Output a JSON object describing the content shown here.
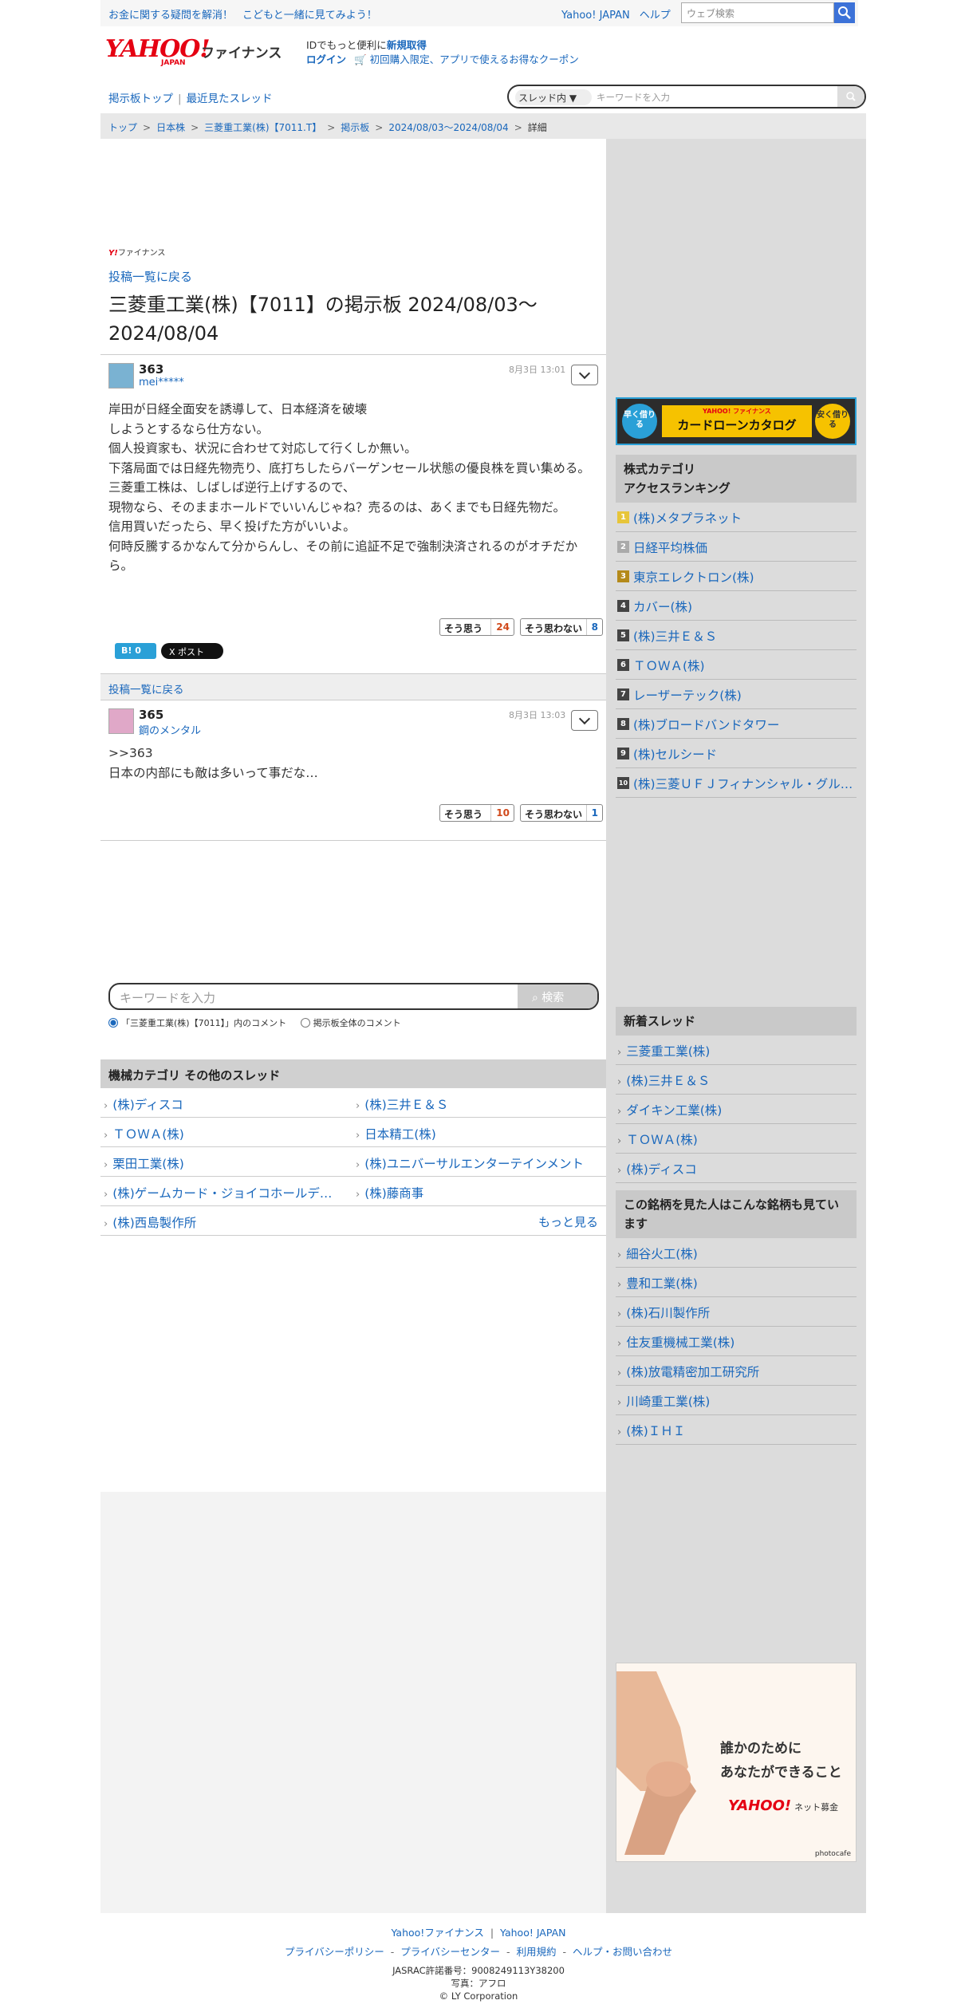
{
  "topbar": {
    "promo_1": "お金に関する疑問を解消！",
    "promo_2": "こどもと一緒に見てみよう！",
    "link_yahoo": "Yahoo! JAPAN",
    "link_help": "ヘルプ",
    "search_placeholder": "ウェブ検索"
  },
  "header": {
    "logo_yahoo": "YAHOO!",
    "logo_japan": "JAPAN",
    "logo_finance": "ファイナンス",
    "id_text": "IDでもっと便利に",
    "id_signup": "新規取得",
    "login": "ログイン",
    "coupon": "初回購入限定、アプリで使えるお得なクーポン"
  },
  "subnav": {
    "board_top": "掲示板トップ",
    "recent": "最近見たスレッド"
  },
  "thread_search": {
    "scope": "スレッド内",
    "placeholder": "キーワードを入力"
  },
  "breadcrumb": [
    "トップ",
    "日本株",
    "三菱重工業(株)【7011.T】",
    "掲示板",
    "2024/08/03〜2024/08/04",
    "詳細"
  ],
  "main": {
    "small_logo_y": "Y!",
    "small_logo_text": "ファイナンス",
    "back_label": "投稿一覧に戻る",
    "title": "三菱重工業(株)【7011】の掲示板 2024/08/03〜2024/08/04",
    "posts": [
      {
        "num": "363",
        "user": "mei*****",
        "date": "8月3日 13:01",
        "lines": [
          "岸田が日経全面安を誘導して、日本経済を破壊",
          "しようとするなら仕方ない。",
          "個人投資家も、状況に合わせて対応して行くしか無い。",
          "下落局面では日経先物売り、底打ちしたらバーゲンセール状態の優良株を買い集める。",
          "三菱重工株は、しばしば逆行上げするので、",
          "現物なら、そのままホールドでいいんじゃね？売るのは、あくまでも日経先物だ。",
          "信用買いだったら、早く投げた方がいいよ。",
          "何時反騰するかなんて分からんし、その前に追証不足で強制決済されるのがオチだから。"
        ],
        "yes_label": "そう思う",
        "yes_count": "24",
        "no_label": "そう思わない",
        "no_count": "8"
      },
      {
        "num": "365",
        "user": "鋼のメンタル",
        "date": "8月3日 13:03",
        "lines": [
          ">>363",
          "日本の内部にも敵は多いって事だな…"
        ],
        "yes_label": "そう思う",
        "yes_count": "10",
        "no_label": "そう思わない",
        "no_count": "1"
      }
    ],
    "hatena": "B! 0",
    "xpost": "X ポスト",
    "keyword_search": {
      "placeholder": "キーワードを入力",
      "button": "検索",
      "scope_1": "「三菱重工業(株)【7011】」内のコメント",
      "scope_2": "掲示板全体のコメント"
    },
    "category": {
      "heading": "機械カテゴリ その他のスレッド",
      "items": [
        "(株)ディスコ",
        "(株)三井Ｅ＆Ｓ",
        "ＴＯＷＡ(株)",
        "日本精工(株)",
        "栗田工業(株)",
        "(株)ユニバーサルエンターテインメント",
        "(株)ゲームカード・ジョイコホールデ…",
        "(株)藤商事",
        "(株)西島製作所"
      ],
      "more": "もっと見る"
    }
  },
  "right": {
    "banner": {
      "left": "早く借りる",
      "brand": "YAHOO! ファイナンス",
      "title": "カードローンカタログ",
      "right": "安く借りる"
    },
    "ranking_heading_1": "株式カテゴリ",
    "ranking_heading_2": "アクセスランキング",
    "ranking": [
      "(株)メタプラネット",
      "日経平均株価",
      "東京エレクトロン(株)",
      "カバー(株)",
      "(株)三井Ｅ＆Ｓ",
      "ＴＯＷＡ(株)",
      "レーザーテック(株)",
      "(株)ブロードバンドタワー",
      "(株)セルシード",
      "(株)三菱ＵＦＪフィナンシャル・グループ"
    ],
    "new_threads_heading": "新着スレッド",
    "new_threads": [
      "三菱重工業(株)",
      "(株)三井Ｅ＆Ｓ",
      "ダイキン工業(株)",
      "ＴＯＷＡ(株)",
      "(株)ディスコ"
    ],
    "also_viewed_heading": "この銘柄を見た人はこんな銘柄も見ています",
    "also_viewed": [
      "細谷火工(株)",
      "豊和工業(株)",
      "(株)石川製作所",
      "住友重機械工業(株)",
      "(株)放電精密加工研究所",
      "川崎重工業(株)",
      "(株)ＩＨＩ"
    ],
    "bokin": {
      "line1": "誰かのために",
      "line2": "あなたができること",
      "logo": "YAHOO!",
      "logo_sub": "ネット募金",
      "credit": "photocafe"
    }
  },
  "footer": {
    "l1": [
      "Yahoo!ファイナンス",
      "Yahoo! JAPAN"
    ],
    "l2": [
      "プライバシーポリシー",
      "プライバシーセンター",
      "利用規約",
      "ヘルプ・お問い合わせ"
    ],
    "jasrac": "JASRAC許諾番号：9008249113Y38200",
    "photo": "写真：アフロ",
    "copyright": "© LY Corporation"
  }
}
